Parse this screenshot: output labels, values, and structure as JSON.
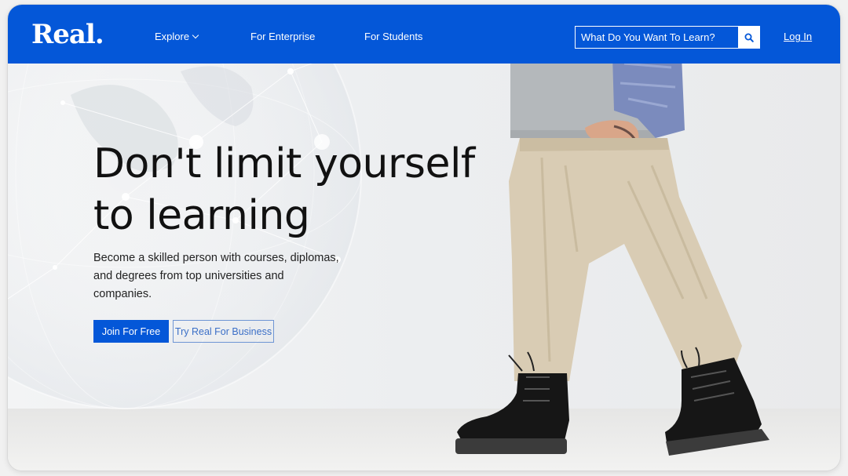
{
  "brand": {
    "logo_text": "Real."
  },
  "nav": {
    "links": [
      {
        "label": "Explore"
      },
      {
        "label": "For Enterprise"
      },
      {
        "label": "For Students"
      }
    ],
    "search": {
      "placeholder": "What Do You Want To Learn?"
    },
    "login_label": "Log In"
  },
  "hero": {
    "headline_line1": "Don't limit yourself",
    "headline_line2": "to learning",
    "subtext": "Become a skilled person with courses, diplomas, and degrees from top universities and companies.",
    "primary_cta": "Join For Free",
    "secondary_cta": "Try Real For Business"
  },
  "colors": {
    "brand_blue": "#0457d8",
    "secondary_outline": "#6e95d4"
  },
  "icons": [
    "search-icon",
    "chevron-down-icon"
  ]
}
